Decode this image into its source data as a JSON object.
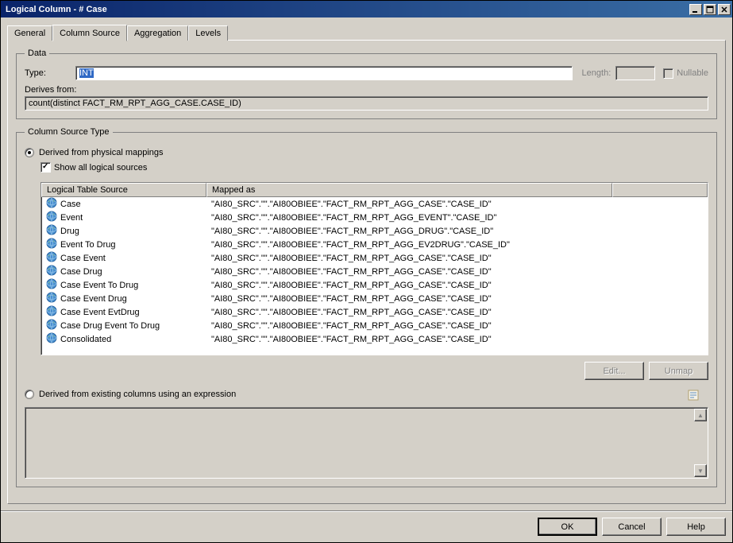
{
  "window": {
    "title": "Logical Column - # Case"
  },
  "tabs": [
    {
      "label": "General"
    },
    {
      "label": "Column Source"
    },
    {
      "label": "Aggregation"
    },
    {
      "label": "Levels"
    }
  ],
  "data_group": {
    "legend": "Data",
    "type_label": "Type:",
    "type_value": "INT",
    "length_label": "Length:",
    "nullable_label": "Nullable",
    "derives_label": "Derives from:",
    "derives_value": "count(distinct FACT_RM_RPT_AGG_CASE.CASE_ID)"
  },
  "source_group": {
    "legend": "Column Source Type",
    "radio1_label": "Derived from physical mappings",
    "show_all_label": "Show all logical sources",
    "table": {
      "col1": "Logical Table Source",
      "col2": "Mapped as",
      "rows": [
        {
          "name": "Case",
          "mapped": "\"AI80_SRC\".\"\".\"AI80OBIEE\".\"FACT_RM_RPT_AGG_CASE\".\"CASE_ID\""
        },
        {
          "name": "Event",
          "mapped": "\"AI80_SRC\".\"\".\"AI80OBIEE\".\"FACT_RM_RPT_AGG_EVENT\".\"CASE_ID\""
        },
        {
          "name": "Drug",
          "mapped": "\"AI80_SRC\".\"\".\"AI80OBIEE\".\"FACT_RM_RPT_AGG_DRUG\".\"CASE_ID\""
        },
        {
          "name": "Event To Drug",
          "mapped": "\"AI80_SRC\".\"\".\"AI80OBIEE\".\"FACT_RM_RPT_AGG_EV2DRUG\".\"CASE_ID\""
        },
        {
          "name": "Case Event",
          "mapped": "\"AI80_SRC\".\"\".\"AI80OBIEE\".\"FACT_RM_RPT_AGG_CASE\".\"CASE_ID\""
        },
        {
          "name": "Case Drug",
          "mapped": "\"AI80_SRC\".\"\".\"AI80OBIEE\".\"FACT_RM_RPT_AGG_CASE\".\"CASE_ID\""
        },
        {
          "name": "Case Event To Drug",
          "mapped": "\"AI80_SRC\".\"\".\"AI80OBIEE\".\"FACT_RM_RPT_AGG_CASE\".\"CASE_ID\""
        },
        {
          "name": "Case Event Drug",
          "mapped": "\"AI80_SRC\".\"\".\"AI80OBIEE\".\"FACT_RM_RPT_AGG_CASE\".\"CASE_ID\""
        },
        {
          "name": "Case Event EvtDrug",
          "mapped": "\"AI80_SRC\".\"\".\"AI80OBIEE\".\"FACT_RM_RPT_AGG_CASE\".\"CASE_ID\""
        },
        {
          "name": "Case Drug Event To Drug",
          "mapped": "\"AI80_SRC\".\"\".\"AI80OBIEE\".\"FACT_RM_RPT_AGG_CASE\".\"CASE_ID\""
        },
        {
          "name": "Consolidated",
          "mapped": "\"AI80_SRC\".\"\".\"AI80OBIEE\".\"FACT_RM_RPT_AGG_CASE\".\"CASE_ID\""
        }
      ]
    },
    "edit_btn": "Edit...",
    "unmap_btn": "Unmap",
    "radio2_label": "Derived from existing columns using an expression"
  },
  "footer": {
    "ok": "OK",
    "cancel": "Cancel",
    "help": "Help"
  }
}
